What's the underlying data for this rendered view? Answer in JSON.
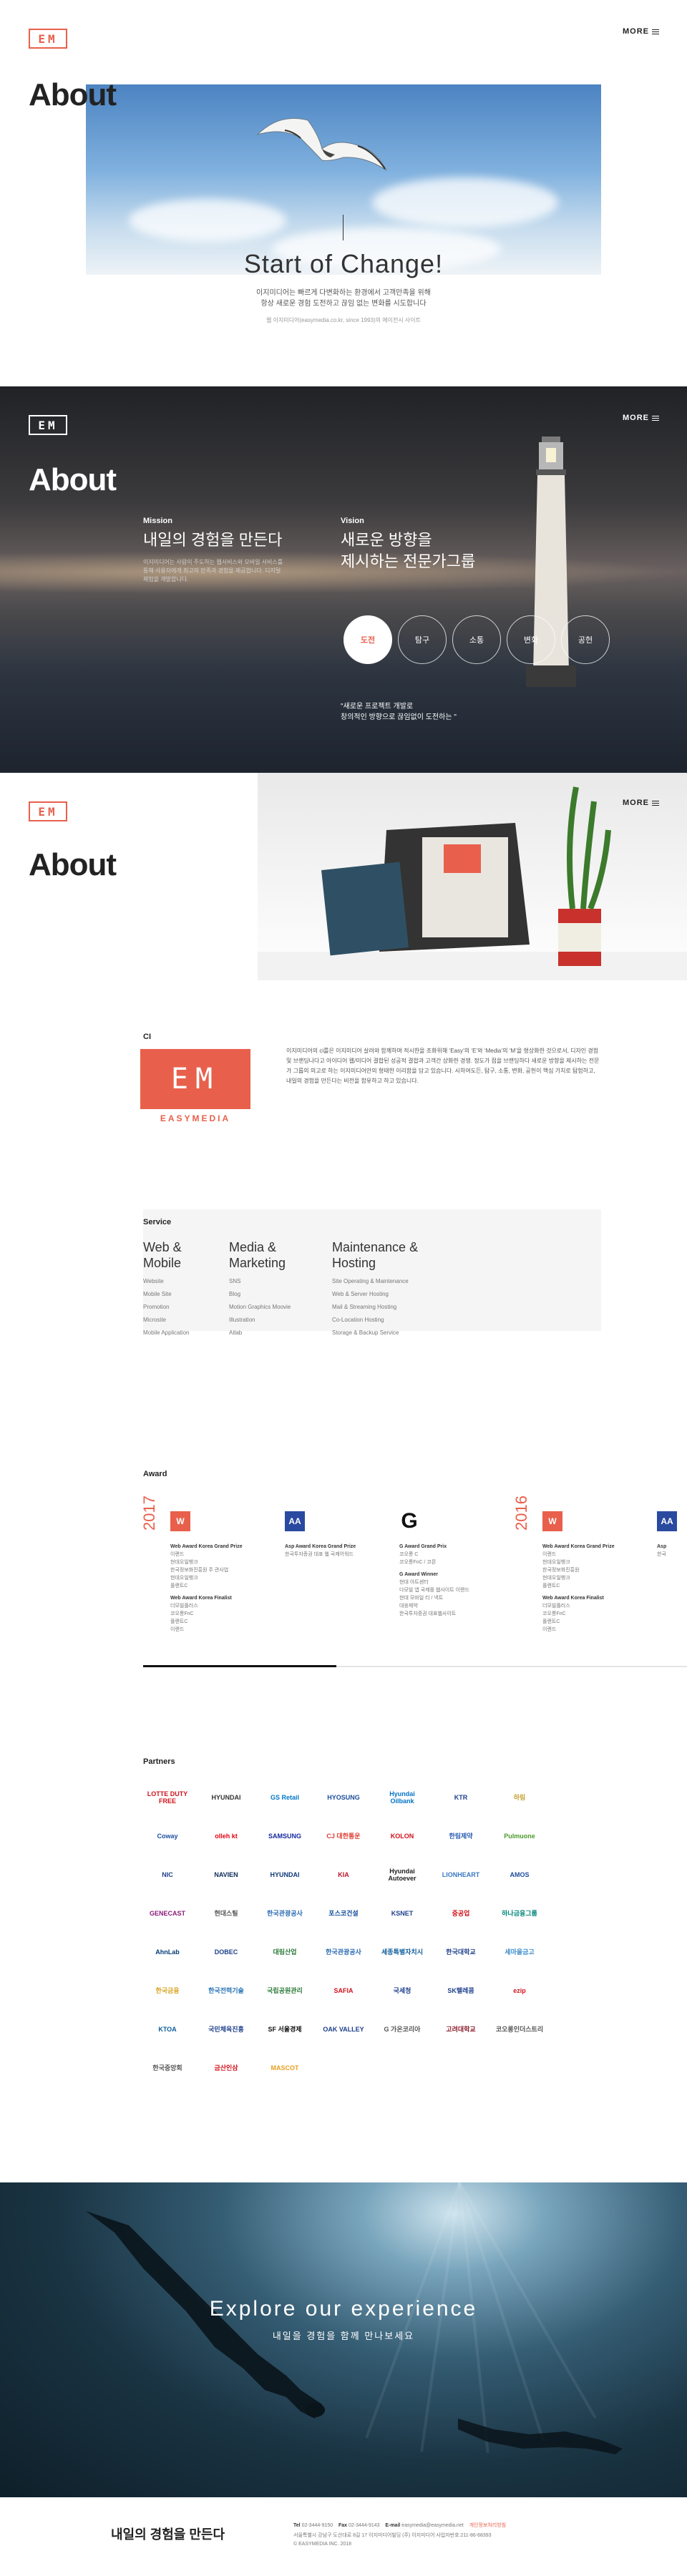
{
  "header": {
    "logo_text": "EM",
    "more_label": "MORE"
  },
  "section1": {
    "title": "About",
    "headline": "Start of Change!",
    "text_line1": "이지미디어는 빠르게 다변화하는 환경에서 고객만족을 위해",
    "text_line2": "항상 새로운 경험 도전하고 끊임 없는 변화를 시도합니다",
    "small": "웹 이지미디어(easymedia.co.kr, since 1993)의 에이전시 사이트"
  },
  "section2": {
    "title": "About",
    "mission_label": "Mission",
    "mission_title": "내일의 경험을 만든다",
    "mission_text": "이지미디어는 사람이 주도하는 웹서비스와 모바일 서비스를 통해 사용자에게 최고의 만족과 경험을 제공합니다. 디지털 체험을 개발합니다.",
    "vision_label": "Vision",
    "vision_title_line1": "새로운 방향을",
    "vision_title_line2": "제시하는 전문가그룹",
    "circles": [
      "도전",
      "탐구",
      "소통",
      "변화",
      "공헌"
    ],
    "quote_line1": "\"새로운 프로젝트 개발로",
    "quote_line2": "창의적인 방향으로 끊임없이 도전하는 \""
  },
  "section3": {
    "title": "About",
    "ci_label": "CI",
    "ci_logo_text": "EM",
    "ci_word": "EASYMEDIA",
    "ci_text": "이지미디어의 ci를은 이지미디어 살려와 함께하며 적시한을 조화위해 ‘Easy’의 ‘E’와 ‘Media’의 ‘M’을 형상화한 것으로서, 디자인 경험 및 브랜딩나다고 아이디어 웹/미디어 결합된 성공적 결합과 고객간 상화한 경쟁. 정도가 점을 브랜딩하다 새로운 방향을 제시하는 전문가 그룹의 의고로 하는 이지미디어만의 형태한 이리함을 담고 있습니다. 시하여도든, 탐구, 소통, 변화, 공헌이 핵심 가치로 탐험하고, 내일의 경험을 만든다는 비전을 함유하고 하고 있습니다.",
    "service_label": "Service",
    "services": [
      {
        "title_line1": "Web &",
        "title_line2": "Mobile",
        "items": [
          "Website",
          "Mobile Site",
          "Promotion",
          "Microsite",
          "Mobile Application"
        ]
      },
      {
        "title_line1": "Media &",
        "title_line2": "Marketing",
        "items": [
          "SNS",
          "Blog",
          "Motion Graphics Moovie",
          "Illustration",
          "Atlab"
        ]
      },
      {
        "title_line1": "Maintenance &",
        "title_line2": "Hosting",
        "items": [
          "Site Operating & Maintenance",
          "Web & Server Hosting",
          "Mail & Streaming Hosting",
          "Co-Location Hosting",
          "Storage & Backup Service"
        ]
      }
    ]
  },
  "awards": {
    "label": "Award",
    "years": [
      "2017",
      "2016"
    ],
    "items": [
      {
        "icon": "W",
        "kind": "wa",
        "head": "Web Award Korea Grand Prize",
        "lines": [
          "이랜드",
          "현대오일뱅크",
          "한국정보화진흥원 주 관사업",
          "현대오일뱅크",
          "플랜트C"
        ],
        "head2": "Web Award Korea Finalist",
        "lines2": [
          "더모빌플러스",
          "코오롱FnC",
          "플랜트C",
          "이랜드"
        ]
      },
      {
        "icon": "AA",
        "kind": "aa",
        "head": "Asp Award Korea Grand Prize",
        "lines": [
          "한국투자증권 대표 웹 국제어워드"
        ],
        "head2": "",
        "lines2": []
      },
      {
        "icon": "G",
        "kind": "ga",
        "head": "G Award Grand Prix",
        "lines": [
          "코오롱 C",
          "코오롱FnC / 코몬"
        ],
        "head2": "G Award Winner",
        "lines2": [
          "현대 아트센터",
          "다모빌 앱 국제를 웹사이트 이랜드",
          "현대 모바일 티 / 넥트",
          "대웅제약",
          "한국투자증권 대표웹사이트"
        ]
      },
      {
        "icon": "W",
        "kind": "wa",
        "head": "Web Award Korea Grand Prize",
        "lines": [
          "이랜드",
          "현대오일뱅크",
          "한국정보화진흥원",
          "현대오일뱅크",
          "플랜트C"
        ],
        "head2": "Web Award Korea Finalist",
        "lines2": [
          "더모빌플러스",
          "코오롱FnC",
          "플랜트C",
          "이랜드"
        ]
      },
      {
        "icon": "AA",
        "kind": "aa",
        "head": "Asp",
        "lines": [
          "한국"
        ],
        "head2": "",
        "lines2": []
      }
    ]
  },
  "partners": {
    "label": "Partners",
    "logos": [
      {
        "name": "LOTTE DUTY FREE",
        "color": "#d0121b"
      },
      {
        "name": "HYUNDAI",
        "color": "#333333"
      },
      {
        "name": "GS Retail",
        "color": "#0078c8"
      },
      {
        "name": "HYOSUNG",
        "color": "#1d4c9c"
      },
      {
        "name": "Hyundai Oilbank",
        "color": "#0073c5"
      },
      {
        "name": "KTR",
        "color": "#1d3f8c"
      },
      {
        "name": "하림",
        "color": "#c5a030"
      },
      {
        "name": "Coway",
        "color": "#1e50a0"
      },
      {
        "name": "olleh kt",
        "color": "#e60012"
      },
      {
        "name": "SAMSUNG",
        "color": "#1428a0"
      },
      {
        "name": "CJ 대한통운",
        "color": "#e03c31"
      },
      {
        "name": "KOLON",
        "color": "#d0121b"
      },
      {
        "name": "한림제약",
        "color": "#2a5db0"
      },
      {
        "name": "Pulmuone",
        "color": "#4b9b2b"
      },
      {
        "name": "NIC",
        "color": "#1d3f8c"
      },
      {
        "name": "NAVIEN",
        "color": "#102b5a"
      },
      {
        "name": "HYUNDAI",
        "color": "#0c3a7a"
      },
      {
        "name": "KIA",
        "color": "#bb162b"
      },
      {
        "name": "Hyundai Autoever",
        "color": "#222222"
      },
      {
        "name": "LIONHEART",
        "color": "#3a78c2"
      },
      {
        "name": "AMOS",
        "color": "#1d4c9c"
      },
      {
        "name": "GENECAST",
        "color": "#8a1c7a"
      },
      {
        "name": "현대스틸",
        "color": "#555555"
      },
      {
        "name": "한국관광공사",
        "color": "#2a6ab2"
      },
      {
        "name": "포스코건설",
        "color": "#0f4a9a"
      },
      {
        "name": "KSNET",
        "color": "#1d3f8c"
      },
      {
        "name": "중공업",
        "color": "#d0121b"
      },
      {
        "name": "하나금융그룹",
        "color": "#00877a"
      },
      {
        "name": "AhnLab",
        "color": "#003b7b"
      },
      {
        "name": "DOBEC",
        "color": "#1d3f8c"
      },
      {
        "name": "대림산업",
        "color": "#2b7b3a"
      },
      {
        "name": "한국관광공사",
        "color": "#2a6ab2"
      },
      {
        "name": "세종특별자치시",
        "color": "#0c5a9a"
      },
      {
        "name": "한국대학교",
        "color": "#1d3f8c"
      },
      {
        "name": "세마을금고",
        "color": "#3b8ccb"
      },
      {
        "name": "한국금융",
        "color": "#d7a320"
      },
      {
        "name": "한국전력기술",
        "color": "#1f6fb3"
      },
      {
        "name": "국립공원관리",
        "color": "#2b7b3a"
      },
      {
        "name": "SAFIA",
        "color": "#d0121b"
      },
      {
        "name": "국세청",
        "color": "#1d3f8c"
      },
      {
        "name": "SK텔레콤",
        "color": "#1d3f8c"
      },
      {
        "name": "ezip",
        "color": "#d0121b"
      },
      {
        "name": "KTOA",
        "color": "#0c5a9a"
      },
      {
        "name": "국민체육진흥",
        "color": "#1d3f8c"
      },
      {
        "name": "SF 서울경제",
        "color": "#111111"
      },
      {
        "name": "OAK VALLEY",
        "color": "#1d3f8c"
      },
      {
        "name": "G 가온코리아",
        "color": "#555555"
      },
      {
        "name": "고려대학교",
        "color": "#8b1c2c"
      },
      {
        "name": "코오롱인더스트리",
        "color": "#555555"
      },
      {
        "name": "한국중앙회",
        "color": "#555555"
      },
      {
        "name": "금산인삼",
        "color": "#d0121b"
      },
      {
        "name": "MASCOT",
        "color": "#e8a020"
      }
    ]
  },
  "explore": {
    "title": "Explore our experience",
    "subtitle": "내일을 경험을 함께 만나보세요"
  },
  "footer": {
    "title": "내일의 경험을 만든다",
    "tel_label": "Tel",
    "tel": "02-3444-9150",
    "fax_label": "Fax",
    "fax": "02-3444-9143",
    "email_label": "E-mail",
    "email": "easymedia@easymedia.net",
    "privacy": "개인정보처리방침",
    "address": "서울특별시 강남구 도산대로 8길 17 이지미디어빌딩 (주) 이지미디어 사업자번호:211-86-68393",
    "copyright": "© EASYMEDIA INC. 2018"
  }
}
